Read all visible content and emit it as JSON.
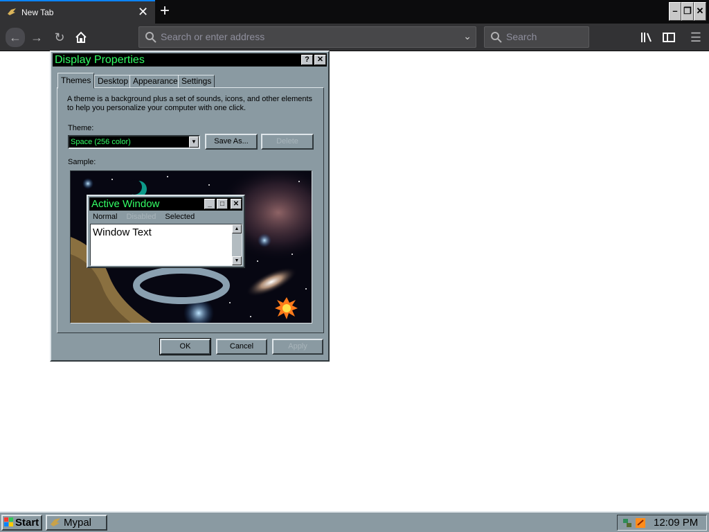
{
  "browser": {
    "tab_title": "New Tab",
    "url_placeholder": "Search or enter address",
    "search_placeholder": "Search",
    "window_buttons": {
      "minimize": "–",
      "restore": "❐",
      "close": "✕"
    }
  },
  "dialog": {
    "title": "Display Properties",
    "help_button": "?",
    "close_button": "✕",
    "tabs": [
      "Themes",
      "Desktop",
      "Appearance",
      "Settings"
    ],
    "description": "A theme is a background plus a set of sounds, icons, and other elements to help you personalize your computer with one click.",
    "theme_label": "Theme:",
    "theme_value": "Space (256 color)",
    "save_as_label": "Save As...",
    "delete_label": "Delete",
    "sample_label": "Sample:",
    "preview": {
      "title": "Active Window",
      "menu": {
        "normal": "Normal",
        "disabled": "Disabled",
        "selected": "Selected"
      },
      "body_text": "Window Text"
    },
    "ok_label": "OK",
    "cancel_label": "Cancel",
    "apply_label": "Apply"
  },
  "taskbar": {
    "start_label": "Start",
    "task_label": "Mypal",
    "clock": "12:09 PM"
  },
  "colors": {
    "title_text": "#33ff66",
    "dialog_face": "#8a9aa2",
    "accent": "#0a84ff"
  }
}
